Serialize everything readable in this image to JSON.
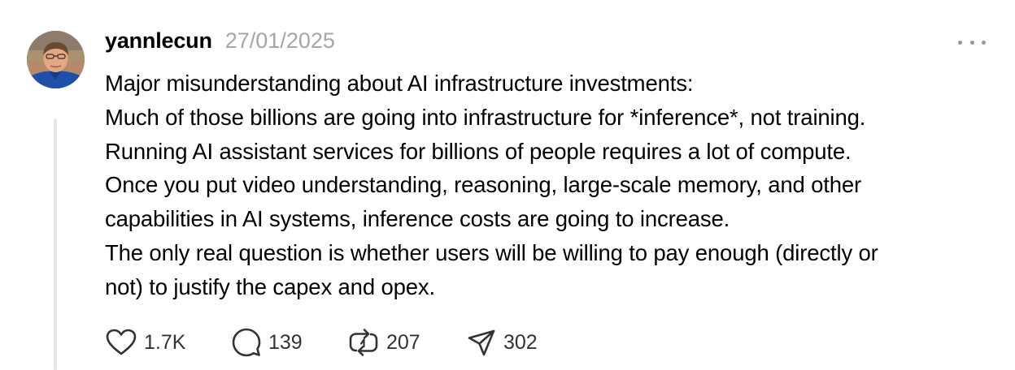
{
  "post": {
    "author": {
      "username": "yannlecun",
      "timestamp": "27/01/2025"
    },
    "body_lines": [
      "Major misunderstanding about AI infrastructure investments:",
      "Much of those billions are going into infrastructure for *inference*, not training.",
      "Running AI assistant services for billions of people requires a lot of compute.",
      "Once you put video understanding, reasoning, large-scale memory, and other",
      "capabilities in AI systems, inference costs are going to increase.",
      "The only real question is whether users will be willing to pay enough (directly or",
      "not) to justify the capex and opex."
    ],
    "actions": {
      "like": {
        "icon": "heart-icon",
        "count": "1.7K"
      },
      "reply": {
        "icon": "comment-icon",
        "count": "139"
      },
      "repost": {
        "icon": "repost-icon",
        "count": "207"
      },
      "share": {
        "icon": "send-icon",
        "count": "302"
      }
    },
    "more_menu": {
      "icon": "more-options-icon"
    }
  },
  "colors": {
    "text": "#000000",
    "muted": "#a6a6a6",
    "icon": "#333333",
    "thread_line": "#e6e6e6"
  }
}
